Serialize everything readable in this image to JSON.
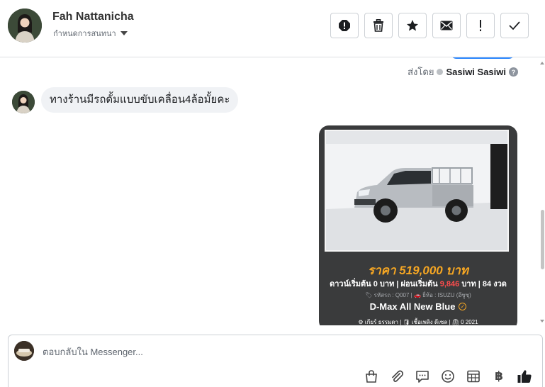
{
  "header": {
    "contact_name": "Fah Nattanicha",
    "label_selector": "กำหนดการสนทนา",
    "actions": [
      "spam-icon",
      "trash-icon",
      "star-icon",
      "mail-icon",
      "exclamation-icon",
      "check-icon"
    ]
  },
  "thread": {
    "sent_by_prefix": "ส่งโดย",
    "sent_by_name": "Sasiwi Sasiwi",
    "help_symbol": "?",
    "incoming_message": "ทางร้านมีรถดั้มแบบขับเคลื่อน4ล้อมั้ยคะ",
    "card": {
      "price": "ราคา 519,000 บาท",
      "terms_prefix": "ดาวน์เริ่มต้น 0 บาท | ผ่อนเริ่มต้น",
      "terms_amount": "9,846",
      "terms_suffix": "บาท | 84 งวด",
      "meta": "🏷 รหัสรถ : Q007 | 🚗 ยี่ห้อ : ISUZU (อีซูซุ)",
      "model": "D-Max All New Blue",
      "model_badge": "✓",
      "specs": "⚙ เกียร์ ธรรมดา   |   🛢 เชื้อเพลิง ดีเซล   |   ⏲ 0 2021"
    }
  },
  "composer": {
    "placeholder": "ตอบกลับใน Messenger...",
    "baht_symbol": "฿",
    "tools": [
      "bag-icon",
      "paperclip-icon",
      "saved-reply-icon",
      "emoji-icon",
      "table-icon",
      "baht-icon",
      "thumbs-up-icon"
    ]
  },
  "colors": {
    "accent": "#2d88ff",
    "price": "#f5a623",
    "highlight_red": "#ff4d4d",
    "card_bg": "#3a3b3c"
  }
}
